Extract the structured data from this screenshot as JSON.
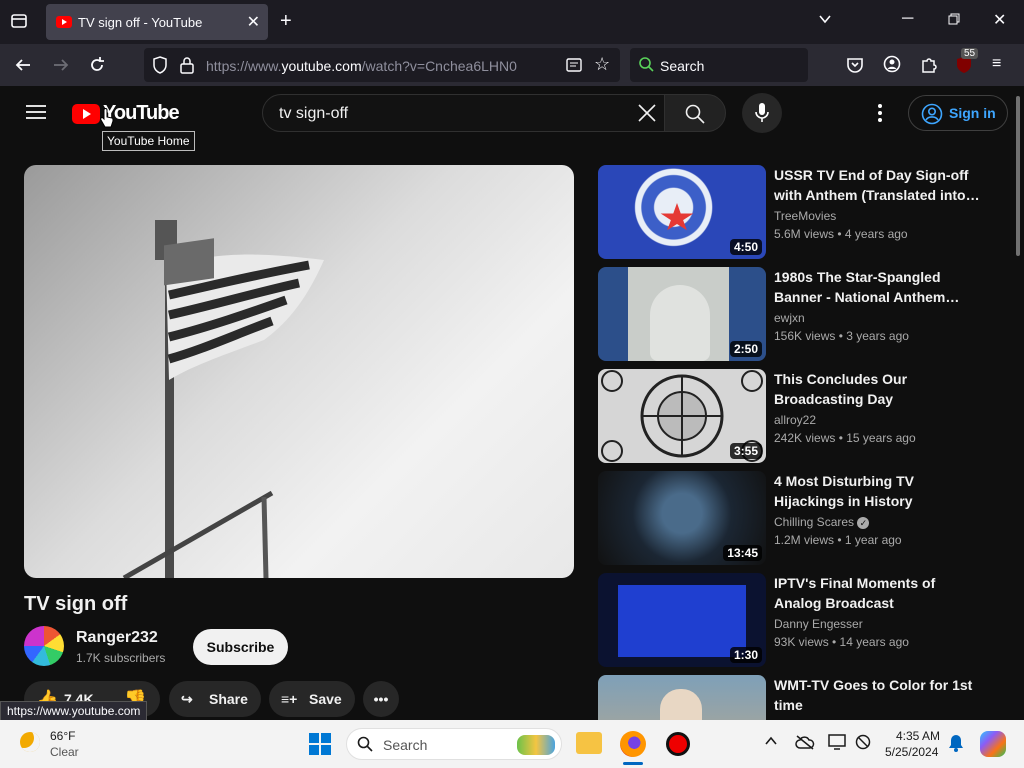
{
  "browser": {
    "tab_title": "TV sign off - YouTube",
    "url_prefix": "https://www.",
    "url_domain": "youtube.com",
    "url_path": "/watch?v=Cnchea6LHN0",
    "search_placeholder": "Search",
    "extension_badge": "55",
    "status_url": "https://www.youtube.com"
  },
  "masthead": {
    "logo_text": "YouTube",
    "tooltip": "YouTube Home",
    "search_query": "tv sign-off",
    "sign_in_label": "Sign in"
  },
  "video": {
    "title": "TV sign off",
    "channel": "Ranger232",
    "subscribers": "1.7K subscribers",
    "subscribe_label": "Subscribe",
    "like_count": "7.4K",
    "share_label": "Share",
    "save_label": "Save"
  },
  "recommendations": [
    {
      "title": "USSR TV End of Day Sign-off with Anthem (Translated into…",
      "channel": "TreeMovies",
      "meta": "5.6M views • 4 years ago",
      "duration": "4:50"
    },
    {
      "title": "1980s The Star-Spangled Banner - National Anthem…",
      "channel": "ewjxn",
      "meta": "156K views • 3 years ago",
      "duration": "2:50"
    },
    {
      "title": "This Concludes Our Broadcasting Day",
      "channel": "allroy22",
      "meta": "242K views • 15 years ago",
      "duration": "3:55"
    },
    {
      "title": "4 Most Disturbing TV Hijackings in History",
      "channel": "Chilling Scares",
      "meta": "1.2M views • 1 year ago",
      "duration": "13:45"
    },
    {
      "title": "IPTV's Final Moments of Analog Broadcast",
      "channel": "Danny Engesser",
      "meta": "93K views • 14 years ago",
      "duration": "1:30"
    },
    {
      "title": "WMT-TV Goes to Color for 1st time",
      "channel": "",
      "meta": "",
      "duration": ""
    }
  ],
  "taskbar": {
    "temperature": "66°F",
    "condition": "Clear",
    "search_label": "Search",
    "time": "4:35 AM",
    "date": "5/25/2024"
  }
}
